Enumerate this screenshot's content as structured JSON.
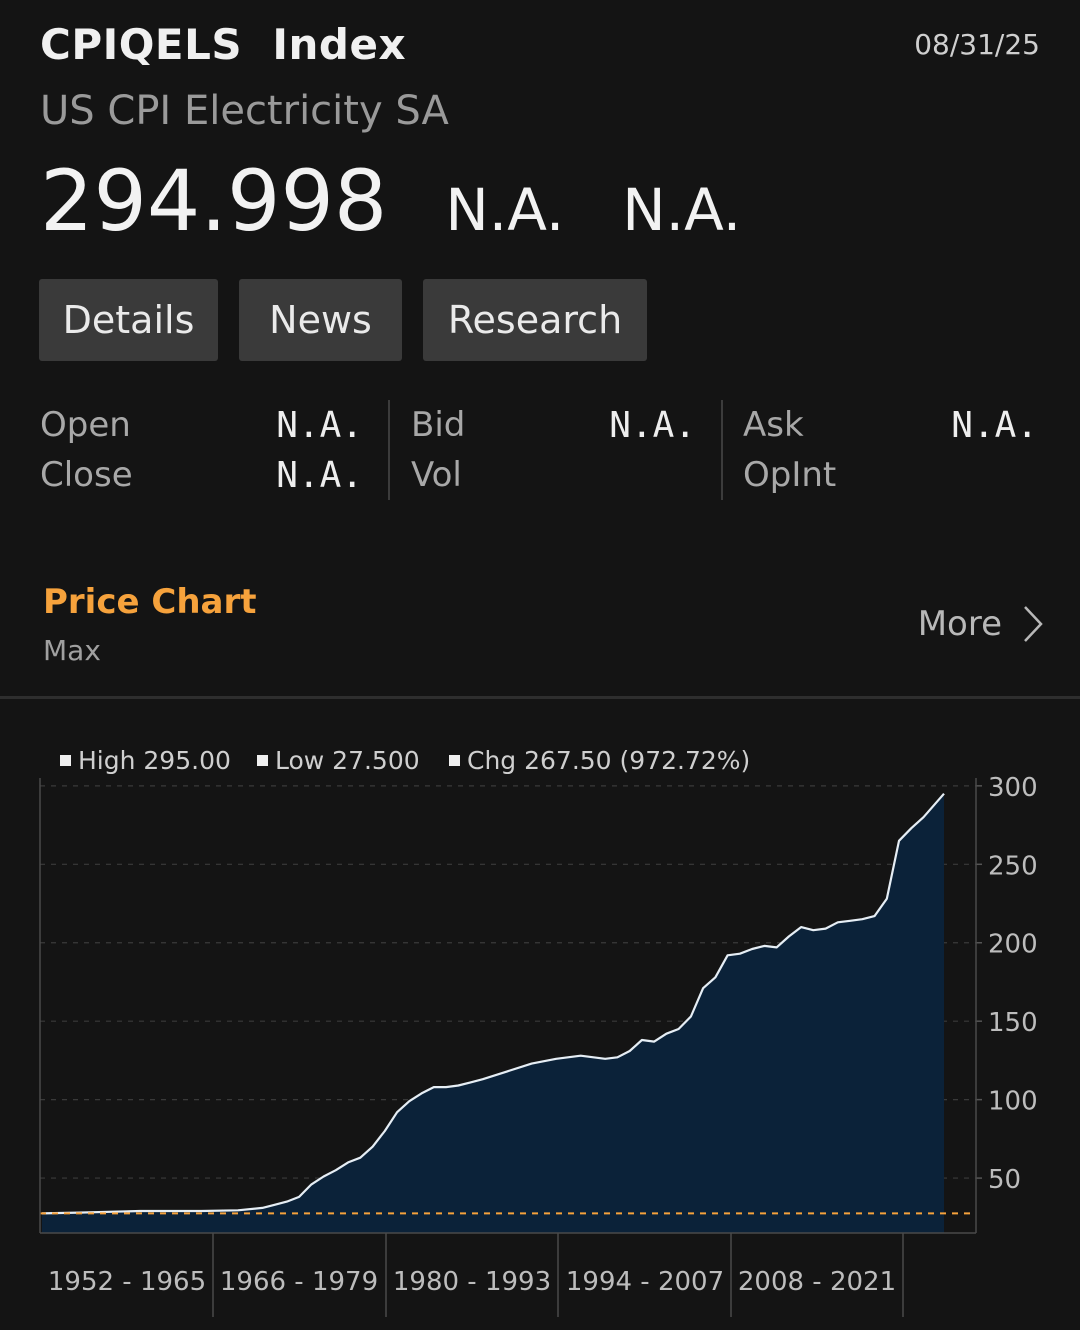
{
  "header": {
    "ticker": "CPIQELS",
    "market": "Index",
    "date": "08/31/25",
    "name": "US CPI Electricity SA"
  },
  "quote": {
    "price": "294.998",
    "change": "N.A.",
    "pct_change": "N.A."
  },
  "tabs": [
    {
      "label": "Details"
    },
    {
      "label": "News"
    },
    {
      "label": "Research"
    }
  ],
  "stats": {
    "open": {
      "label": "Open",
      "value": "N.A."
    },
    "close": {
      "label": "Close",
      "value": "N.A."
    },
    "bid": {
      "label": "Bid",
      "value": "N.A."
    },
    "vol": {
      "label": "Vol",
      "value": ""
    },
    "ask": {
      "label": "Ask",
      "value": "N.A."
    },
    "opint": {
      "label": "OpInt",
      "value": ""
    }
  },
  "section": {
    "title": "Price Chart",
    "period": "Max",
    "more_label": "More"
  },
  "colors": {
    "accent": "#f6a23c",
    "area_fill": "#0b2239",
    "line": "#e6eef5",
    "background": "#141414"
  },
  "chart_data": {
    "type": "area",
    "legend": [
      {
        "label": "High",
        "value": "295.00"
      },
      {
        "label": "Low",
        "value": "27.500"
      },
      {
        "label": "Chg",
        "value": "267.50 (972.72%)"
      }
    ],
    "x_tick_labels": [
      "1952 - 1965",
      "1966 - 1979",
      "1980 - 1993",
      "1994 - 2007",
      "2008 - 2021"
    ],
    "y_ticks": [
      50,
      100,
      150,
      200,
      250,
      300
    ],
    "ylim": [
      15,
      305
    ],
    "xlim": [
      1952,
      2026
    ],
    "reference_line": {
      "value": 27.5,
      "style": "dashed",
      "color": "#f6a23c"
    },
    "grid": true,
    "series": [
      {
        "x": [
          1952,
          1955,
          1960,
          1965,
          1968,
          1970,
          1971,
          1972,
          1973,
          1974,
          1975,
          1976,
          1977,
          1978,
          1979,
          1980,
          1981,
          1982,
          1983,
          1984,
          1985,
          1986,
          1987,
          1988,
          1990,
          1992,
          1994,
          1996,
          1998,
          1999,
          2000,
          2001,
          2002,
          2003,
          2004,
          2005,
          2006,
          2007,
          2008,
          2009,
          2010,
          2011,
          2012,
          2013,
          2014,
          2015,
          2016,
          2017,
          2018,
          2019,
          2020,
          2021,
          2022,
          2023,
          2024,
          2025.67
        ],
        "y": [
          27.5,
          28,
          29,
          29,
          29.5,
          31,
          33,
          35,
          38,
          46,
          51,
          55,
          60,
          63,
          70,
          80,
          92,
          99,
          104,
          108,
          108,
          109,
          111,
          113,
          118,
          123,
          126,
          128,
          126,
          127,
          131,
          138,
          137,
          142,
          145,
          153,
          171,
          178,
          192,
          193,
          196,
          198,
          197,
          204,
          210,
          208,
          209,
          213,
          214,
          215,
          217,
          228,
          265,
          273,
          280,
          295
        ]
      }
    ]
  }
}
